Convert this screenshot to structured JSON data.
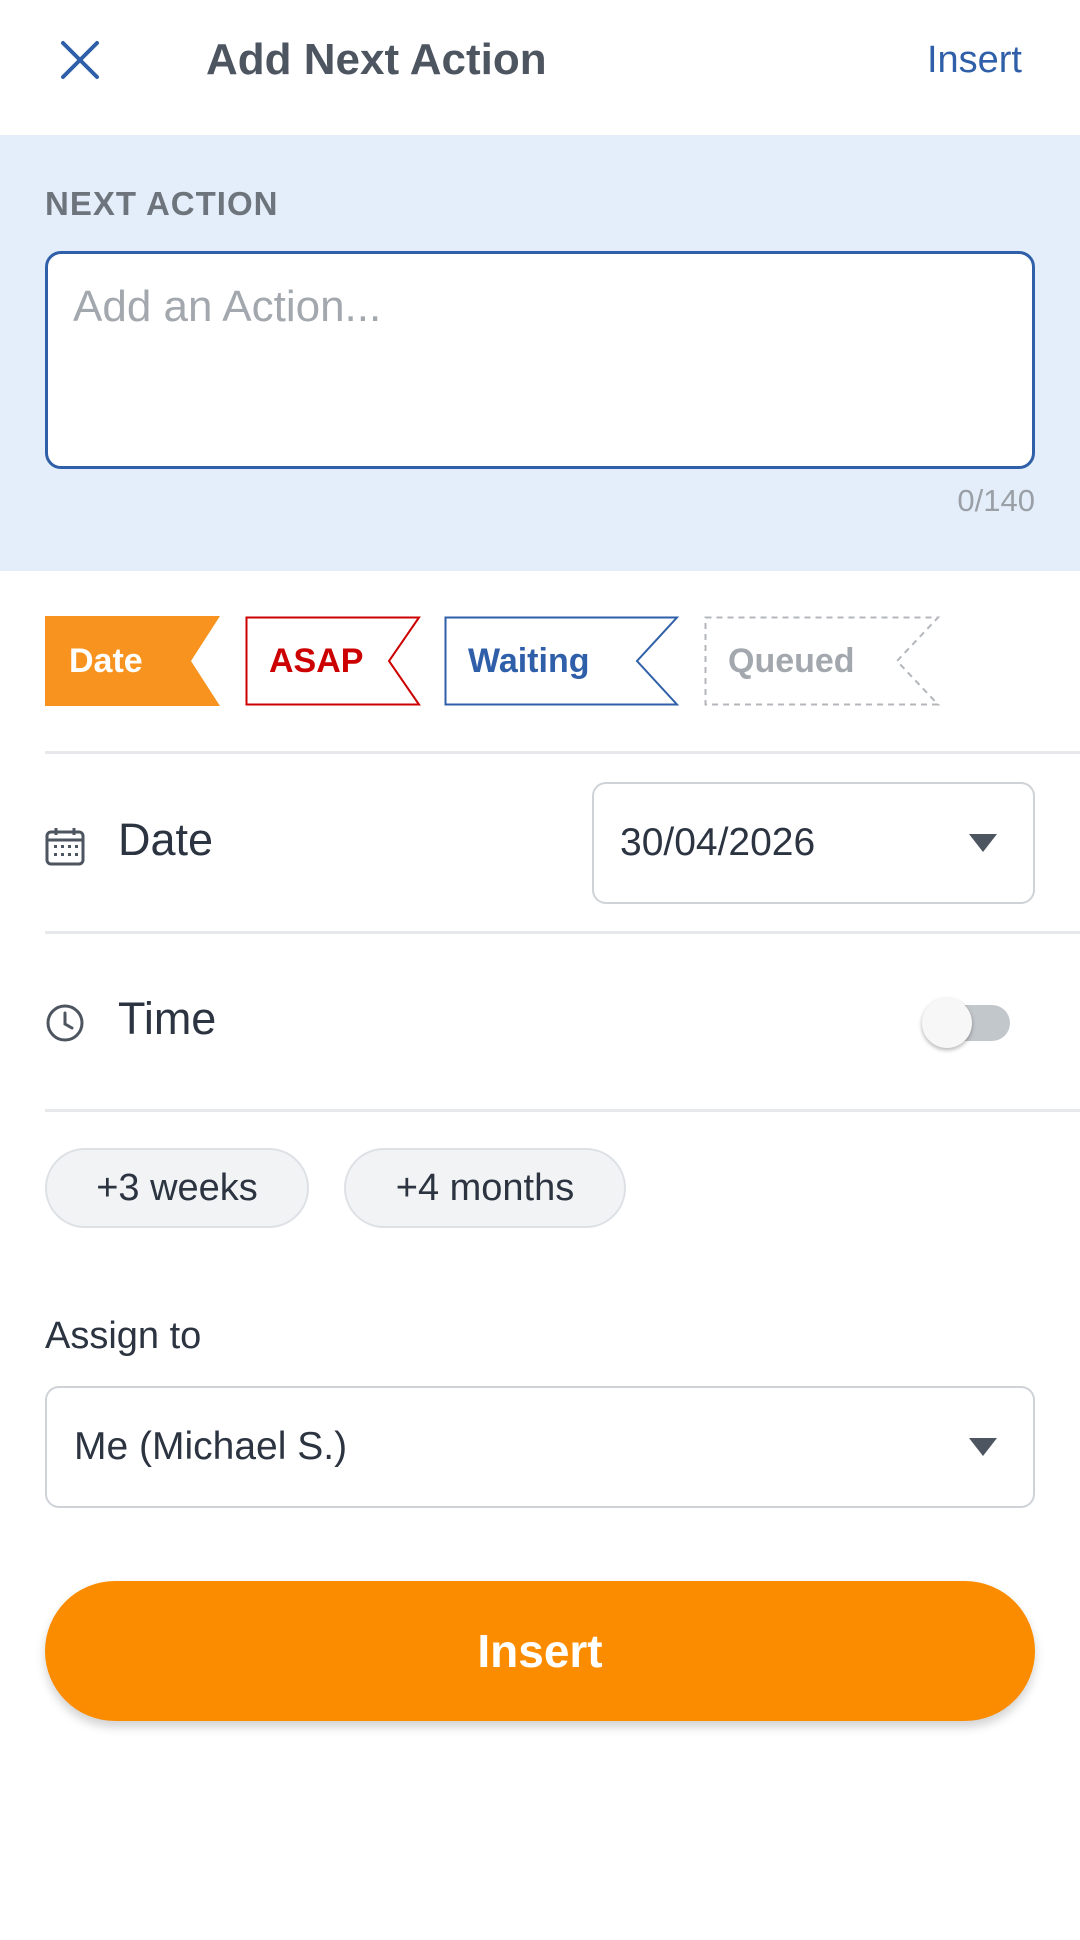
{
  "header": {
    "title": "Add Next Action",
    "action_label": "Insert"
  },
  "next_action": {
    "label": "NEXT ACTION",
    "placeholder": "Add an Action...",
    "value": "",
    "char_count": "0/140"
  },
  "tags": [
    {
      "label": "Date",
      "selected": true,
      "color": "#f7931e"
    },
    {
      "label": "ASAP",
      "selected": false,
      "color": "#cc0000"
    },
    {
      "label": "Waiting",
      "selected": false,
      "color": "#2f5fa8"
    },
    {
      "label": "Queued",
      "selected": false,
      "color": "#a3a8ae"
    }
  ],
  "date_row": {
    "label": "Date",
    "icon": "calendar-icon",
    "value": "30/04/2026"
  },
  "time_row": {
    "label": "Time",
    "icon": "clock-icon",
    "enabled": false
  },
  "quick_offsets": [
    "+3 weeks",
    "+4 months"
  ],
  "assign": {
    "label": "Assign to",
    "value": "Me (Michael S.)"
  },
  "submit_label": "Insert",
  "colors": {
    "primary_blue": "#2f5fa8",
    "accent_orange": "#fb8c00",
    "panel_bg": "#e4eefb"
  }
}
